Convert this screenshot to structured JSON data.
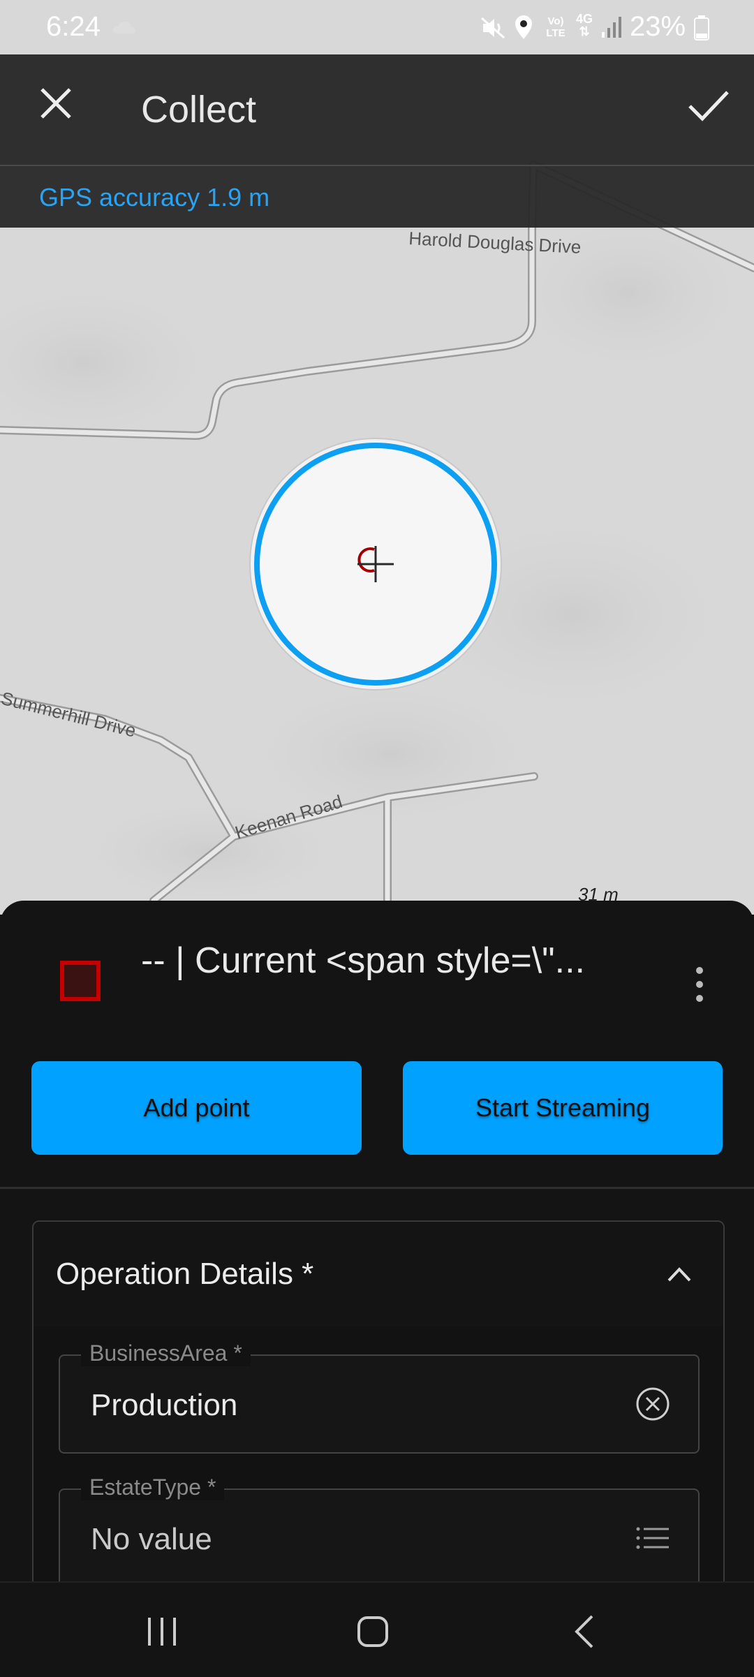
{
  "status_bar": {
    "time": "6:24",
    "battery": "23%",
    "network": "4G",
    "icons": [
      "cloud-icon",
      "mute-icon",
      "location-icon",
      "volte-icon",
      "network-4g-icon",
      "signal-icon",
      "battery-icon"
    ]
  },
  "app_bar": {
    "title": "Collect",
    "close_icon": "close-icon",
    "confirm_icon": "check-icon"
  },
  "gps_banner": {
    "text": "GPS accuracy 1.9 m"
  },
  "map": {
    "roads": [
      "Harold Douglas Drive",
      "Summerhill Drive",
      "Keenan Road"
    ],
    "scale": "31 m",
    "accuracy_ring_color": "#0c9ff2"
  },
  "feature": {
    "title": "-- | Current <span style=\\\"...",
    "symbol_color": "#c40000"
  },
  "actions": {
    "add_point": "Add point",
    "start_streaming": "Start Streaming",
    "button_color": "#00a1ff"
  },
  "section": {
    "title": "Operation Details *",
    "fields": [
      {
        "label": "BusinessArea *",
        "value": "Production",
        "icon": "clear-icon"
      },
      {
        "label": "EstateType *",
        "value": "No value",
        "icon": "list-icon"
      }
    ]
  }
}
